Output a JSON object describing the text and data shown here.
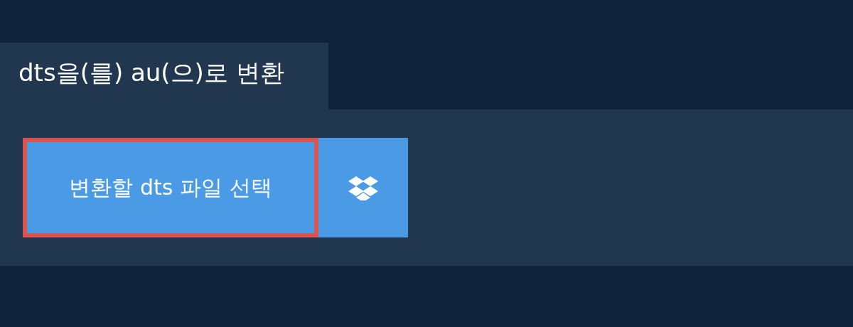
{
  "tab": {
    "label": "dts을(를) au(으)로 변환",
    "selected": true
  },
  "upload_button": {
    "label": "변환할 dts 파일 선택",
    "focused": true
  }
}
